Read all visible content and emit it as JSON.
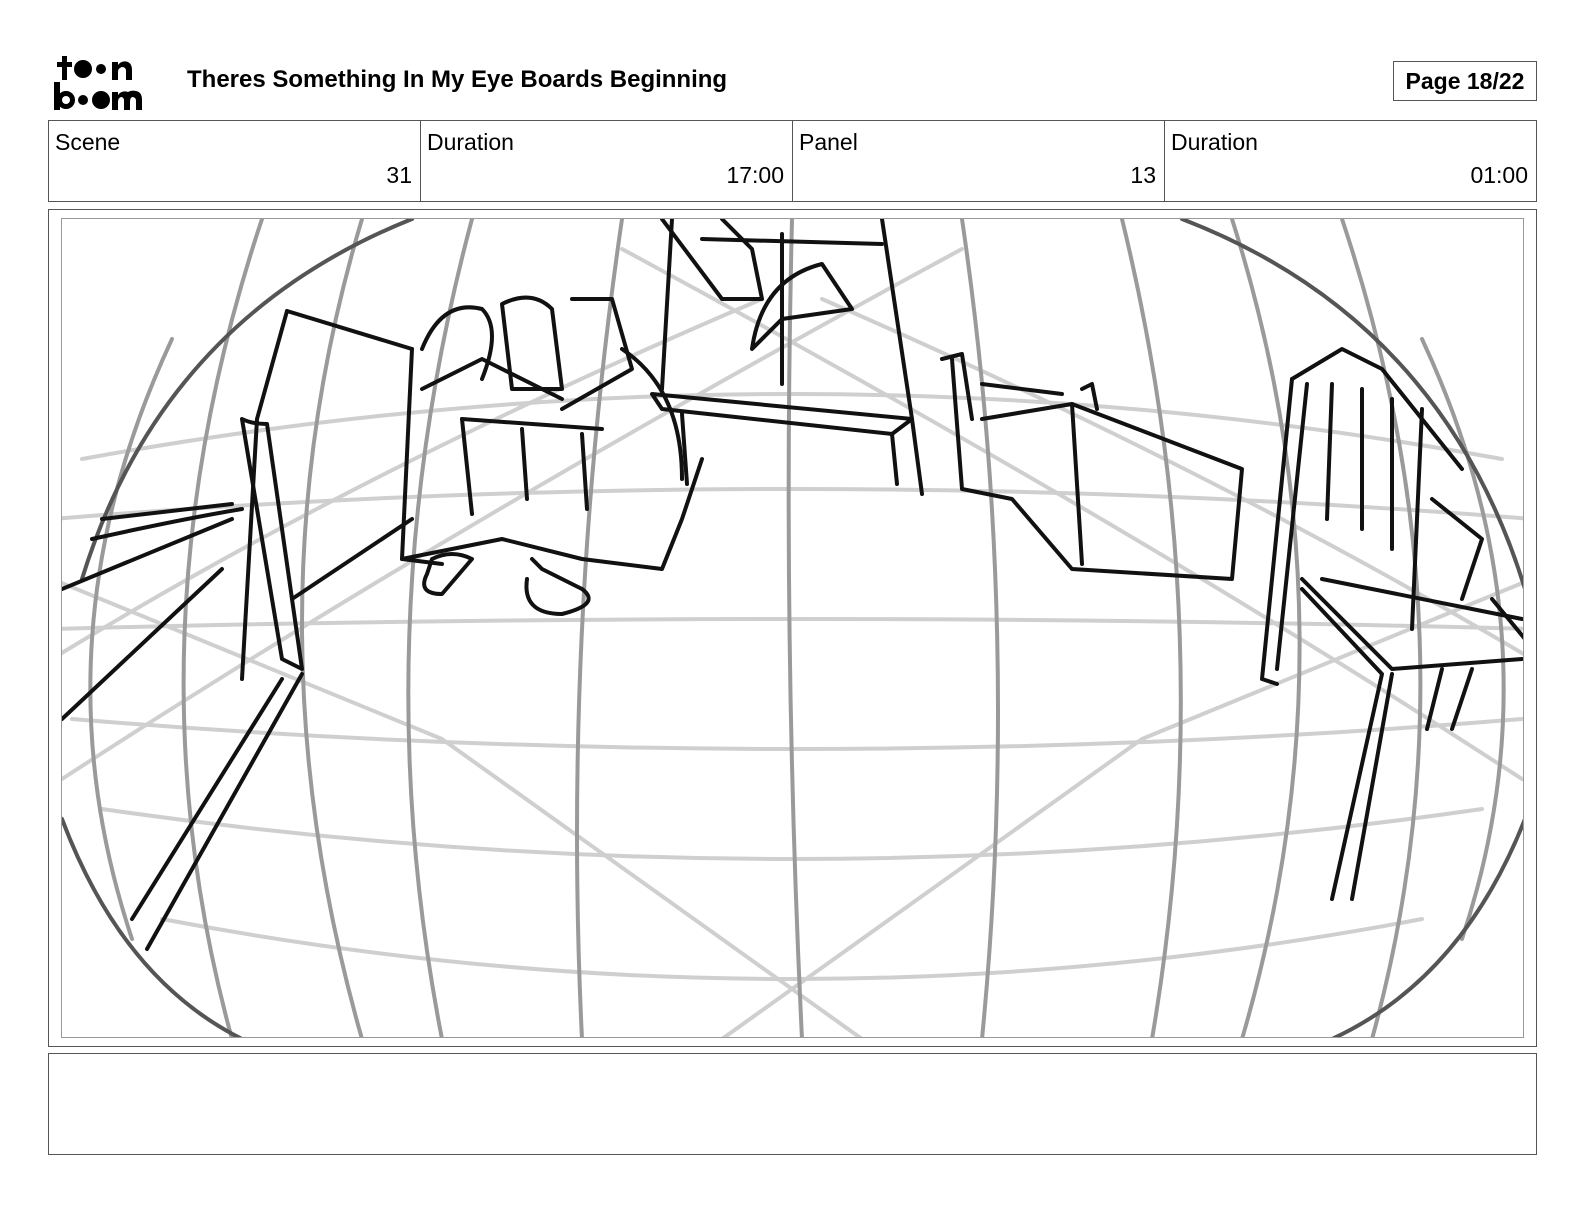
{
  "header": {
    "logo_text": "toon boom",
    "title": "Theres Something In My Eye Boards Beginning",
    "page": "Page 18/22"
  },
  "info": {
    "scene_label": "Scene",
    "scene_value": "31",
    "scene_duration_label": "Duration",
    "scene_duration_value": "17:00",
    "panel_label": "Panel",
    "panel_value": "13",
    "panel_duration_label": "Duration",
    "panel_duration_value": "01:00"
  },
  "notes": {
    "text": ""
  }
}
